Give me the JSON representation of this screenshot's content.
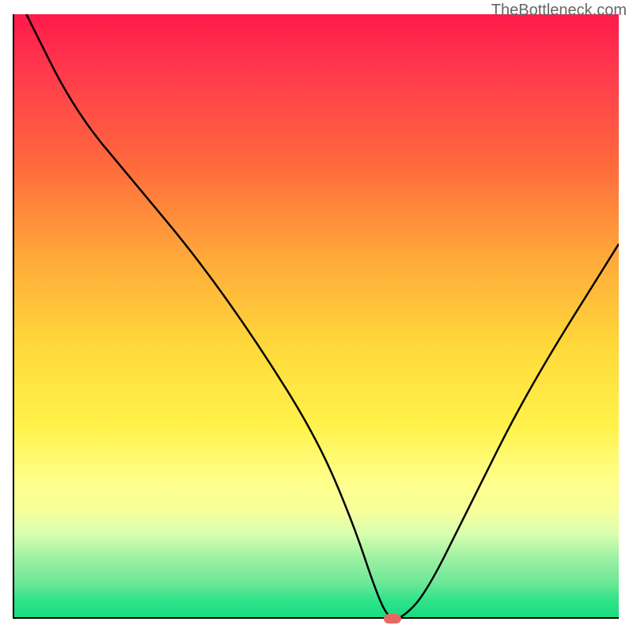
{
  "watermark": "TheBottleneck.com",
  "chart_data": {
    "type": "line",
    "title": "",
    "xlabel": "",
    "ylabel": "",
    "xlim": [
      0,
      100
    ],
    "ylim": [
      0,
      100
    ],
    "x": [
      2,
      10,
      20,
      30,
      40,
      50,
      56,
      60,
      62,
      64,
      68,
      75,
      85,
      100
    ],
    "values": [
      100,
      84,
      72,
      60,
      46,
      30,
      16,
      4,
      0,
      0,
      4,
      18,
      38,
      62
    ],
    "marker": {
      "x": 62.5,
      "y": 0
    },
    "gradient_stops": [
      {
        "pos": 0,
        "color": "#ff1a4a"
      },
      {
        "pos": 25,
        "color": "#ff6a3c"
      },
      {
        "pos": 55,
        "color": "#ffd93a"
      },
      {
        "pos": 82,
        "color": "#f8ff9a"
      },
      {
        "pos": 100,
        "color": "#18db80"
      }
    ]
  }
}
